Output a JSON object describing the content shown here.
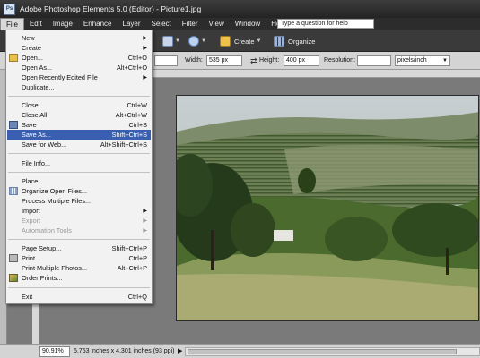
{
  "window": {
    "title": "Adobe Photoshop Elements 5.0 (Editor) - Picture1.jpg",
    "app_icon": "photoshop-elements-icon"
  },
  "menubar": {
    "items": [
      "File",
      "Edit",
      "Image",
      "Enhance",
      "Layer",
      "Select",
      "Filter",
      "View",
      "Window",
      "Help"
    ],
    "help_placeholder": "Type a question for help"
  },
  "toolbar": {
    "create_label": "Create",
    "organize_label": "Organize"
  },
  "options": {
    "width_label": "Width:",
    "width_value": "535 px",
    "height_label": "Height:",
    "height_value": "400 px",
    "resolution_label": "Resolution:",
    "resolution_value": "",
    "resolution_unit": "pixels/inch"
  },
  "file_menu": {
    "items": [
      {
        "label": "New",
        "shortcut": "",
        "submenu": true,
        "disabled": false,
        "icon": ""
      },
      {
        "label": "Create",
        "shortcut": "",
        "submenu": true,
        "disabled": false,
        "icon": ""
      },
      {
        "label": "Open...",
        "shortcut": "Ctrl+O",
        "submenu": false,
        "disabled": false,
        "icon": "folder-icon"
      },
      {
        "label": "Open As...",
        "shortcut": "Alt+Ctrl+O",
        "submenu": false,
        "disabled": false,
        "icon": ""
      },
      {
        "label": "Open Recently Edited File",
        "shortcut": "",
        "submenu": true,
        "disabled": false,
        "icon": ""
      },
      {
        "label": "Duplicate...",
        "shortcut": "",
        "submenu": false,
        "disabled": false,
        "icon": ""
      },
      {
        "label": "Close",
        "shortcut": "Ctrl+W",
        "submenu": false,
        "disabled": false,
        "icon": ""
      },
      {
        "label": "Close All",
        "shortcut": "Alt+Ctrl+W",
        "submenu": false,
        "disabled": false,
        "icon": ""
      },
      {
        "label": "Save",
        "shortcut": "Ctrl+S",
        "submenu": false,
        "disabled": false,
        "icon": "save-disk-icon"
      },
      {
        "label": "Save As...",
        "shortcut": "Shift+Ctrl+S",
        "submenu": false,
        "disabled": false,
        "icon": "",
        "highlighted": true
      },
      {
        "label": "Save for Web...",
        "shortcut": "Alt+Shift+Ctrl+S",
        "submenu": false,
        "disabled": false,
        "icon": ""
      },
      {
        "label": "File Info...",
        "shortcut": "",
        "submenu": false,
        "disabled": false,
        "icon": ""
      },
      {
        "label": "Place...",
        "shortcut": "",
        "submenu": false,
        "disabled": false,
        "icon": ""
      },
      {
        "label": "Organize Open Files...",
        "shortcut": "",
        "submenu": false,
        "disabled": false,
        "icon": "organize-grid-icon"
      },
      {
        "label": "Process Multiple Files...",
        "shortcut": "",
        "submenu": false,
        "disabled": false,
        "icon": ""
      },
      {
        "label": "Import",
        "shortcut": "",
        "submenu": true,
        "disabled": false,
        "icon": ""
      },
      {
        "label": "Export",
        "shortcut": "",
        "submenu": true,
        "disabled": true,
        "icon": ""
      },
      {
        "label": "Automation Tools",
        "shortcut": "",
        "submenu": true,
        "disabled": true,
        "icon": ""
      },
      {
        "label": "Page Setup...",
        "shortcut": "Shift+Ctrl+P",
        "submenu": false,
        "disabled": false,
        "icon": ""
      },
      {
        "label": "Print...",
        "shortcut": "Ctrl+P",
        "submenu": false,
        "disabled": false,
        "icon": "printer-icon"
      },
      {
        "label": "Print Multiple Photos...",
        "shortcut": "Alt+Ctrl+P",
        "submenu": false,
        "disabled": false,
        "icon": ""
      },
      {
        "label": "Order Prints...",
        "shortcut": "",
        "submenu": false,
        "disabled": false,
        "icon": "order-prints-icon"
      },
      {
        "label": "Exit",
        "shortcut": "Ctrl+Q",
        "submenu": false,
        "disabled": false,
        "icon": ""
      }
    ]
  },
  "statusbar": {
    "zoom": "90.91%",
    "doc_info": "5.753 inches x 4.301 inches (93 ppi)"
  },
  "colors": {
    "highlight": "#3a5fb0",
    "menu_bg": "#f2f2f2",
    "titlebar": "#2c2c2c"
  }
}
